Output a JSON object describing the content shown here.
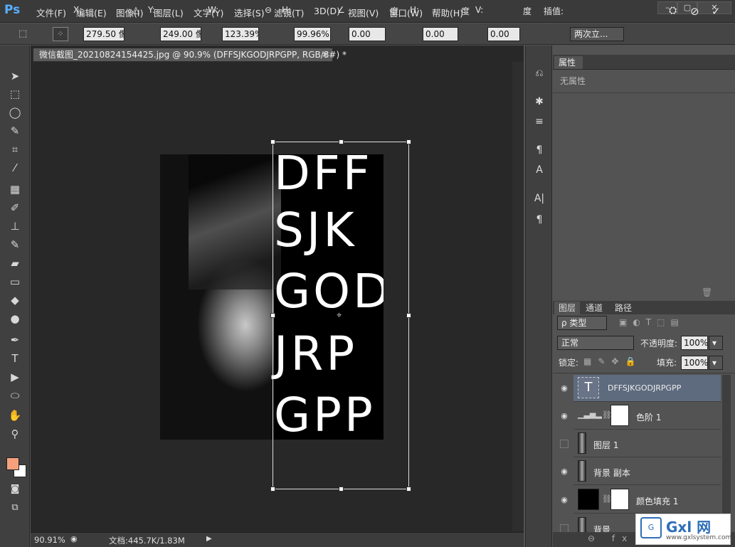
{
  "app": {
    "logo": "Ps",
    "menus": [
      "文件(F)",
      "编辑(E)",
      "图像(I)",
      "图层(L)",
      "文字(Y)",
      "选择(S)",
      "滤镜(T)",
      "3D(D)",
      "视图(V)",
      "窗口(W)",
      "帮助(H)"
    ],
    "window_buttons": [
      "–",
      "▢",
      "✕"
    ]
  },
  "options": {
    "x_label": "X:",
    "x_value": "279.50 像",
    "y_label": "Y:",
    "y_value": "249.00 像",
    "w_label": "W:",
    "w_value": "123.39%",
    "h_label": "H:",
    "h_value": "99.96%",
    "angle_value": "0.00",
    "angle_unit": "度",
    "hskew_label": "H:",
    "hskew_value": "0.00",
    "hskew_unit": "度",
    "vskew_label": "V:",
    "vskew_value": "0.00",
    "vskew_unit": "度",
    "interp_label": "插值:",
    "interp_value": "两次立...",
    "cancel_icon": "⃠",
    "commit_icon": "✓"
  },
  "document": {
    "tab_title": "微信截图_20210824154425.jpg @ 90.9% (DFFSJKGODJRPGPP, RGB/8#) *",
    "close": "×",
    "text_lines": [
      "DFF",
      "SJK",
      "GOD",
      "JRP",
      "GPP"
    ]
  },
  "status": {
    "zoom": "90.91%",
    "doc_info": "文档:445.7K/1.83M"
  },
  "properties": {
    "tab": "属性",
    "empty": "无属性"
  },
  "layers_panel": {
    "tabs": [
      "图层",
      "通道",
      "路径"
    ],
    "filter": "ρ 类型",
    "blend": "正常",
    "opacity_label": "不透明度:",
    "opacity": "100%",
    "lock_label": "锁定:",
    "fill_label": "填充:",
    "fill": "100%",
    "layers": [
      {
        "name": "DFFSJKGODJRPGPP",
        "visible": true,
        "selected": true,
        "thumb": "T"
      },
      {
        "name": "色阶 1",
        "visible": true,
        "selected": false,
        "thumb": "levels"
      },
      {
        "name": "图层 1",
        "visible": false,
        "selected": false,
        "thumb": "photo"
      },
      {
        "name": "背景 副本",
        "visible": true,
        "selected": false,
        "thumb": "photo"
      },
      {
        "name": "颜色填充 1",
        "visible": true,
        "selected": false,
        "thumb": "black"
      },
      {
        "name": "背景",
        "visible": false,
        "selected": false,
        "thumb": "photo"
      }
    ]
  },
  "watermark": {
    "brand": "Gxl 网",
    "url": "www.gxlsystem.com"
  },
  "colors": {
    "foreground": "#f7a07c",
    "background": "#ffffff",
    "accent": "#58b0ff"
  }
}
